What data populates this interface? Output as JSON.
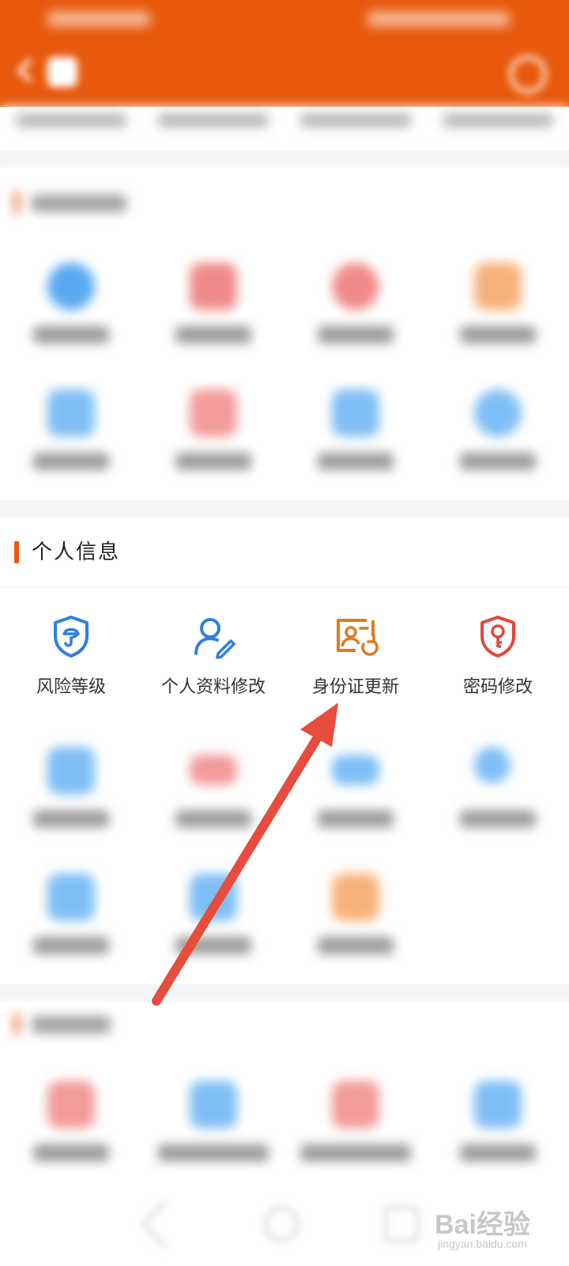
{
  "header": {
    "title": "",
    "accent_color": "#e8590c",
    "back_icon": "chevron-left-icon",
    "home_icon": "home-icon",
    "settings_icon": "gear-icon"
  },
  "section_trade": {
    "title": "",
    "items": [
      {
        "label": "",
        "icon": "check-circle-icon",
        "color": "#5aa9f0"
      },
      {
        "label": "",
        "icon": "chart-icon",
        "color": "#f08a8a"
      },
      {
        "label": "",
        "icon": "circle-icon",
        "color": "#f08a8a"
      },
      {
        "label": "",
        "icon": "square-icon",
        "color": "#f7b27a"
      },
      {
        "label": "",
        "icon": "list-icon",
        "color": "#7fbef5"
      },
      {
        "label": "",
        "icon": "doc-icon",
        "color": "#f39a9a"
      },
      {
        "label": "",
        "icon": "book-icon",
        "color": "#7fbef5"
      },
      {
        "label": "",
        "icon": "circle-icon",
        "color": "#7fbef5"
      }
    ]
  },
  "section_personal": {
    "title": "个人信息",
    "items": [
      {
        "label": "风险等级",
        "icon": "risk-shield-icon"
      },
      {
        "label": "个人资料修改",
        "icon": "profile-edit-icon"
      },
      {
        "label": "身份证更新",
        "icon": "id-card-update-icon"
      },
      {
        "label": "密码修改",
        "icon": "key-shield-icon"
      }
    ],
    "blurred_items": [
      {
        "label": "",
        "icon": "tablet-icon",
        "color": "#7fbef5"
      },
      {
        "label": "",
        "icon": "card-icon",
        "color": "#f39a9a"
      },
      {
        "label": "",
        "icon": "card-icon",
        "color": "#7fbef5"
      },
      {
        "label": "",
        "icon": "user-list-icon",
        "color": "#7fbef5"
      },
      {
        "label": "",
        "icon": "square-icon",
        "color": "#7fbef5"
      },
      {
        "label": "",
        "icon": "square-icon",
        "color": "#7fbef5"
      },
      {
        "label": "",
        "icon": "square-icon",
        "color": "#f7b27a"
      }
    ]
  },
  "section_account": {
    "title": "",
    "items": [
      {
        "label": "",
        "icon": "square-icon",
        "color": "#f39a9a"
      },
      {
        "label": "",
        "icon": "square-icon",
        "color": "#7fbef5"
      },
      {
        "label": "",
        "icon": "square-icon",
        "color": "#f39a9a"
      },
      {
        "label": "",
        "icon": "square-icon",
        "color": "#7fbef5"
      }
    ]
  },
  "annotation": {
    "icon": "pointer-arrow-icon",
    "color": "#e74c3c"
  },
  "watermark": {
    "brand": "Bai经验",
    "sub": "jingyan.baidu.com"
  }
}
